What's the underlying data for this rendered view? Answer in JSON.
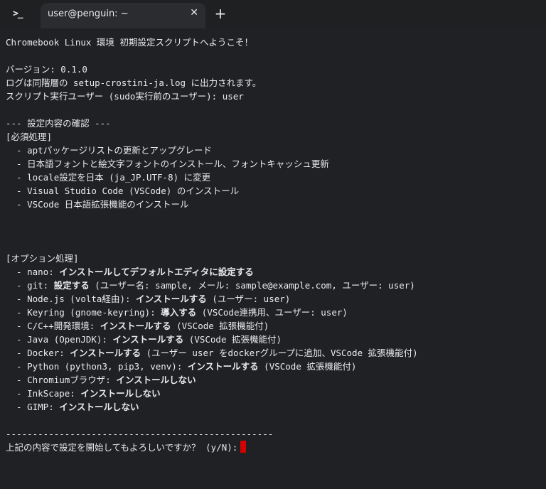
{
  "window": {
    "tab_title": "user@penguin: ~",
    "tab_close_glyph": "✕",
    "new_tab_glyph": "+",
    "app_icon_glyph": ">_"
  },
  "terminal": {
    "welcome": "Chromebook Linux 環境 初期設定スクリプトへようこそ！",
    "version": "バージョン: 0.1.0",
    "log_line": "ログは同階層の setup-crostini-ja.log に出力されます。",
    "user_line": "スクリプト実行ユーザー (sudo実行前のユーザー): user",
    "confirm_header": "--- 設定内容の確認 ---",
    "required_header": "[必須処理]",
    "required_items": [
      "  - aptパッケージリストの更新とアップグレード",
      "  - 日本語フォントと絵文字フォントのインストール、フォントキャッシュ更新",
      "  - locale設定を日本 (ja_JP.UTF-8) に変更",
      "  - Visual Studio Code (VSCode) のインストール",
      "  - VSCode 日本語拡張機能のインストール"
    ],
    "optional_header": "[オプション処理]",
    "optional_items": [
      {
        "prefix": "  - nano: ",
        "action": "インストールしてデフォルトエディタに設定する",
        "suffix": ""
      },
      {
        "prefix": "  - git: ",
        "action": "設定する",
        "suffix": " (ユーザー名: sample, メール: sample@example.com, ユーザー: user)"
      },
      {
        "prefix": "  - Node.js (volta経由): ",
        "action": "インストールする",
        "suffix": " (ユーザー: user)"
      },
      {
        "prefix": "  - Keyring (gnome-keyring): ",
        "action": "導入する",
        "suffix": " (VSCode連携用、ユーザー: user)"
      },
      {
        "prefix": "  - C/C++開発環境: ",
        "action": "インストールする",
        "suffix": " (VSCode 拡張機能付)"
      },
      {
        "prefix": "  - Java (OpenJDK): ",
        "action": "インストールする",
        "suffix": " (VSCode 拡張機能付)"
      },
      {
        "prefix": "  - Docker: ",
        "action": "インストールする",
        "suffix": " (ユーザー user をdockerグループに追加、VSCode 拡張機能付)"
      },
      {
        "prefix": "  - Python (python3, pip3, venv): ",
        "action": "インストールする",
        "suffix": " (VSCode 拡張機能付)"
      },
      {
        "prefix": "  - Chromiumブラウザ: ",
        "action": "インストールしない",
        "suffix": ""
      },
      {
        "prefix": "  - InkScape: ",
        "action": "インストールしない",
        "suffix": ""
      },
      {
        "prefix": "  - GIMP: ",
        "action": "インストールしない",
        "suffix": ""
      }
    ],
    "separator": "--------------------------------------------------",
    "prompt": "上記の内容で設定を開始してもよろしいですか？ (y/N):"
  },
  "colors": {
    "background": "#202124",
    "text": "#e8eaed",
    "cursor": "#d50000"
  }
}
